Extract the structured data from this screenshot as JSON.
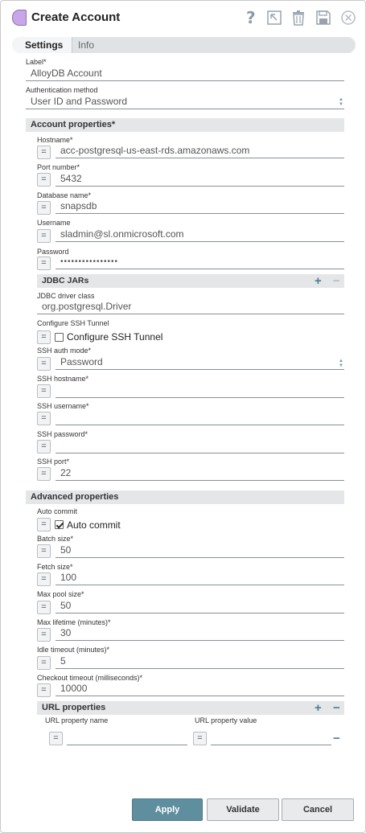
{
  "window": {
    "title": "Create Account"
  },
  "tabs": {
    "settings": "Settings",
    "info": "Info"
  },
  "label": {
    "label": "Label*",
    "value": "AlloyDB Account"
  },
  "auth": {
    "label": "Authentication method",
    "value": "User ID and Password"
  },
  "account_properties": {
    "header": "Account properties*",
    "hostname": {
      "label": "Hostname*",
      "value": "acc-postgresql-us-east-rds.amazonaws.com"
    },
    "port": {
      "label": "Port number*",
      "value": "5432"
    },
    "database": {
      "label": "Database name*",
      "value": "snapsdb"
    },
    "username": {
      "label": "Username",
      "value": "sladmin@sl.onmicrosoft.com"
    },
    "password": {
      "label": "Password",
      "value": "••••••••••••••••"
    },
    "jdbc_jars": {
      "header": "JDBC JARs",
      "add": "+",
      "remove": "−"
    },
    "jdbc_driver": {
      "label": "JDBC driver class",
      "value": "org.postgresql.Driver"
    },
    "ssh_tunnel": {
      "label": "Configure SSH Tunnel",
      "checkbox_label": "Configure SSH Tunnel",
      "checked": false
    },
    "ssh_auth": {
      "label": "SSH auth mode*",
      "value": "Password"
    },
    "ssh_hostname": {
      "label": "SSH hostname*",
      "value": ""
    },
    "ssh_username": {
      "label": "SSH username*",
      "value": ""
    },
    "ssh_password": {
      "label": "SSH password*",
      "value": ""
    },
    "ssh_port": {
      "label": "SSH port*",
      "value": "22"
    }
  },
  "advanced_properties": {
    "header": "Advanced properties",
    "auto_commit": {
      "label": "Auto commit",
      "checkbox_label": "Auto commit",
      "checked": true
    },
    "batch_size": {
      "label": "Batch size*",
      "value": "50"
    },
    "fetch_size": {
      "label": "Fetch size*",
      "value": "100"
    },
    "max_pool": {
      "label": "Max pool size*",
      "value": "50"
    },
    "max_lifetime": {
      "label": "Max lifetime (minutes)*",
      "value": "30"
    },
    "idle_timeout": {
      "label": "Idle timeout (minutes)*",
      "value": "5"
    },
    "checkout_timeout": {
      "label": "Checkout timeout (milliseconds)*",
      "value": "10000"
    },
    "url_properties": {
      "header": "URL properties",
      "add": "+",
      "remove": "−",
      "col_name": "URL property name",
      "col_value": "URL property value",
      "row_remove": "−"
    }
  },
  "eq_symbol": "=",
  "footer": {
    "apply": "Apply",
    "validate": "Validate",
    "cancel": "Cancel"
  },
  "colors": {
    "primary": "#5f8e9f",
    "section_bg": "#e4e6e8",
    "tab_bg": "#dfe3e6",
    "icon": "#9aa3ad"
  }
}
